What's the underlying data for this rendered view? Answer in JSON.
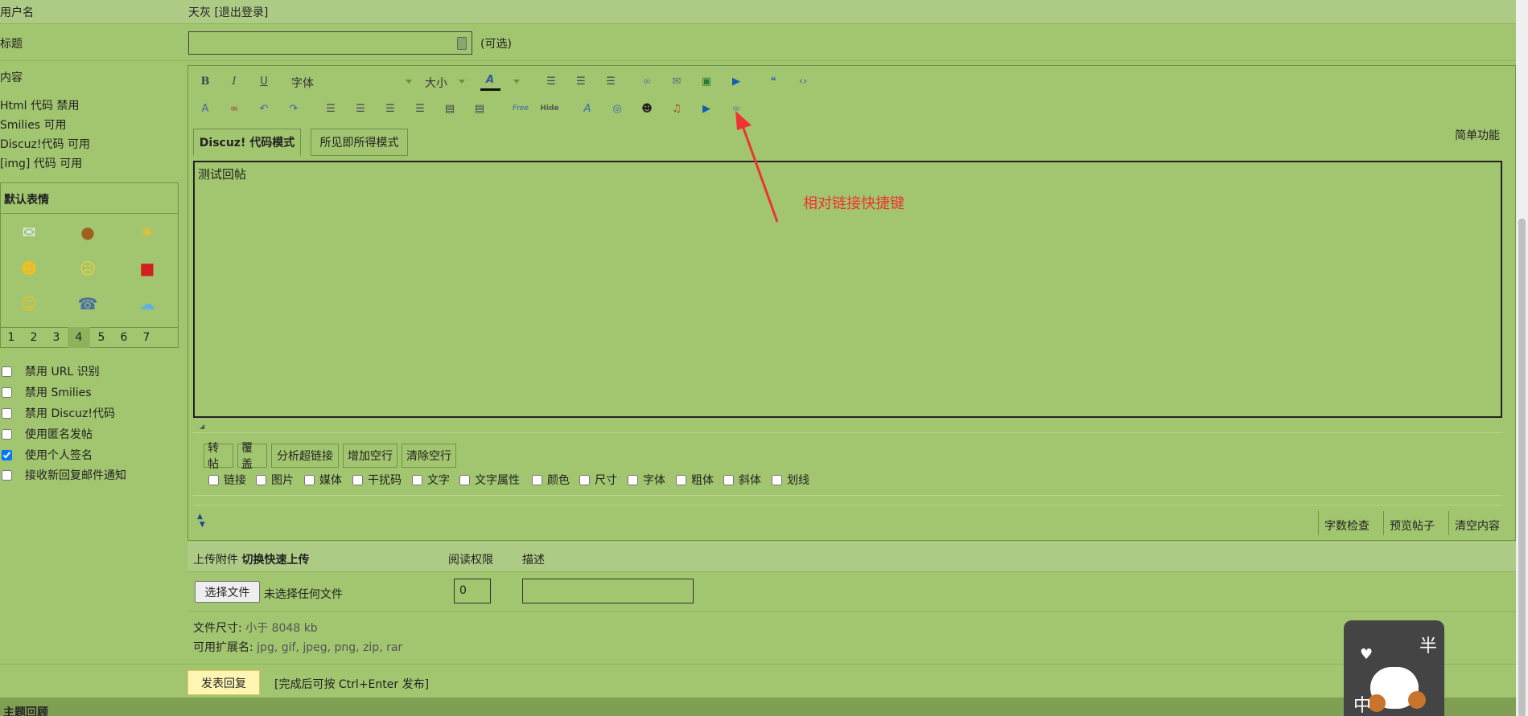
{
  "user_row": {
    "label": "用户名",
    "username": "天灰",
    "logout": "[退出登录]"
  },
  "subject_row": {
    "label": "标题",
    "placeholder": "",
    "hint": "(可选)"
  },
  "content_row": {
    "label": "内容",
    "options": [
      "Html 代码 禁用",
      "Smilies 可用",
      "Discuz!代码 可用",
      "[img] 代码 可用"
    ]
  },
  "smilies": {
    "title": "默认表情",
    "pages": [
      "1",
      "2",
      "3",
      "4",
      "5",
      "6",
      "7"
    ],
    "active_page": "4"
  },
  "post_options": [
    {
      "label": "禁用 URL 识别",
      "checked": false
    },
    {
      "label": "禁用 Smilies",
      "checked": false
    },
    {
      "label": "禁用 Discuz!代码",
      "checked": false
    },
    {
      "label": "使用匿名发帖",
      "checked": false
    },
    {
      "label": "使用个人签名",
      "checked": true
    },
    {
      "label": "接收新回复邮件通知",
      "checked": false
    }
  ],
  "toolbar": {
    "bold": "B",
    "italic": "I",
    "underline": "U",
    "font_label": "字体",
    "size_label": "大小",
    "row2_labels": {
      "free": "Free",
      "hide": "Hide"
    }
  },
  "modes": {
    "code": "Discuz! 代码模式",
    "wysiwyg": "所见即所得模式",
    "simple": "简单功能"
  },
  "editor_text": "测试回帖",
  "annotation": "相对链接快捷键",
  "action_buttons": [
    "转帖",
    "覆盖",
    "分析超链接",
    "增加空行",
    "清除空行"
  ],
  "filters": [
    "链接",
    "图片",
    "媒体",
    "干扰码",
    "文字",
    "文字属性",
    "颜色",
    "尺寸",
    "字体",
    "粗体",
    "斜体",
    "划线"
  ],
  "bottom_links": [
    "字数检查",
    "预览帖子",
    "清空内容"
  ],
  "upload": {
    "head_label": "上传附件",
    "switch_label": "切换快速上传",
    "read_perm": "阅读权限",
    "desc": "描述",
    "choose_file": "选择文件",
    "no_file": "未选择任何文件",
    "perm_value": "0",
    "size_label": "文件尺寸:",
    "size_value": "小于 8048 kb",
    "ext_label": "可用扩展名:",
    "ext_value": "jpg, gif, jpeg, png, zip, rar"
  },
  "submit": {
    "label": "发表回复",
    "hint": "[完成后可按 Ctrl+Enter 发布]"
  },
  "bottom_bar": {
    "label": "主题回顾"
  },
  "mascot": {
    "char1": "半",
    "char2": "中"
  }
}
